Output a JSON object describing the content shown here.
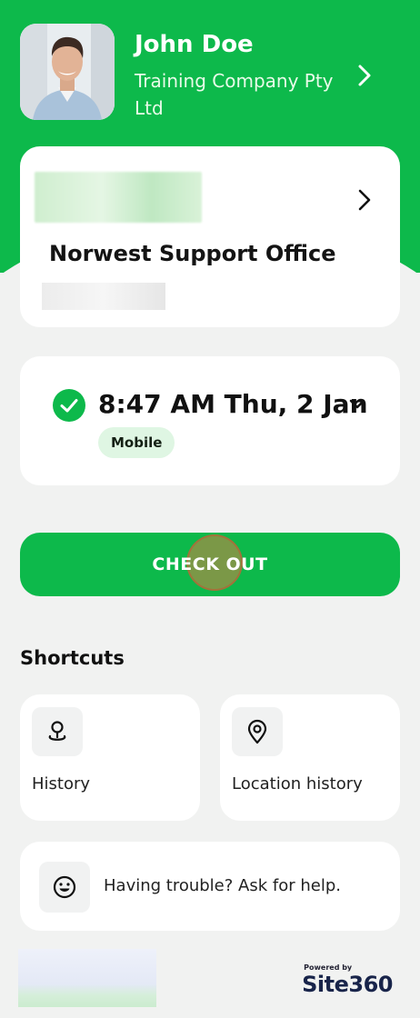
{
  "colors": {
    "brand_green": "#0db94b",
    "background": "#f1f2f1",
    "badge_bg": "#dff6e3"
  },
  "user": {
    "name": "John Doe",
    "company": "Training Company Pty Ltd"
  },
  "site": {
    "name": "Norwest Support Office"
  },
  "attendance": {
    "time": "8:47 AM Thu, 2 Jan",
    "source_badge": "Mobile"
  },
  "actions": {
    "checkout_label": "CHECK OUT"
  },
  "shortcuts": {
    "title": "Shortcuts",
    "items": [
      {
        "label": "History",
        "icon": "history-pin-icon"
      },
      {
        "label": "Location history",
        "icon": "location-pin-icon"
      }
    ]
  },
  "help": {
    "text": "Having trouble?  Ask for help.",
    "icon": "smiley-icon"
  },
  "footer": {
    "powered_by": "Powered by",
    "brand": "Site360"
  }
}
